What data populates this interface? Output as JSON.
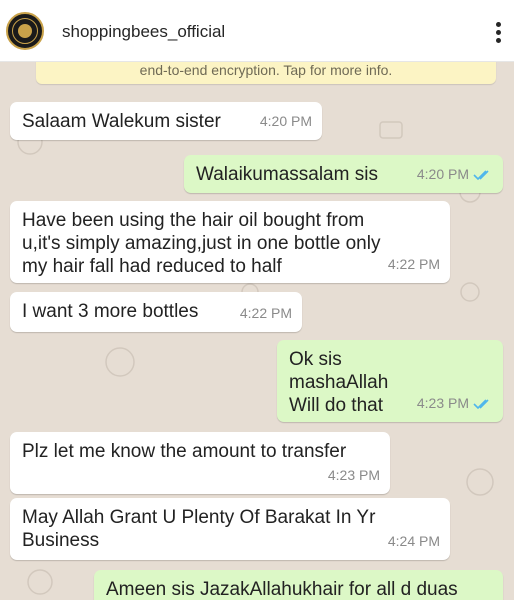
{
  "header": {
    "handle": "shoppingbees_official"
  },
  "system_notice": {
    "text": "end-to-end encryption. Tap for more info."
  },
  "messages": [
    {
      "direction": "in",
      "text": "Salaam Walekum sister",
      "time": "4:20 PM"
    },
    {
      "direction": "out",
      "text": "Walaikumassalam sis",
      "time": "4:20 PM",
      "status": "read"
    },
    {
      "direction": "in",
      "text": "Have been using the hair oil bought from\nu,it's simply amazing,just in one bottle only\nmy hair fall had reduced to half",
      "time": "4:22 PM"
    },
    {
      "direction": "in",
      "text": "I want 3 more bottles",
      "time": "4:22 PM"
    },
    {
      "direction": "out",
      "text": "Ok sis\nmashaAllah\nWill do that",
      "time": "4:23 PM",
      "status": "read"
    },
    {
      "direction": "in",
      "text": "Plz let me know the amount to transfer",
      "time": "4:23 PM"
    },
    {
      "direction": "in",
      "text": "May Allah Grant U Plenty Of Barakat In Yr\nBusiness",
      "time": "4:24 PM"
    },
    {
      "direction": "out",
      "text": "Ameen sis JazakAllahukhair for all d duas",
      "time": ""
    }
  ],
  "colors": {
    "chat_background": "#e6ddd3",
    "incoming_bubble": "#ffffff",
    "outgoing_bubble": "#dcf8c6",
    "read_ticks": "#4fb6ec",
    "notice_background": "#fcf4c4"
  }
}
